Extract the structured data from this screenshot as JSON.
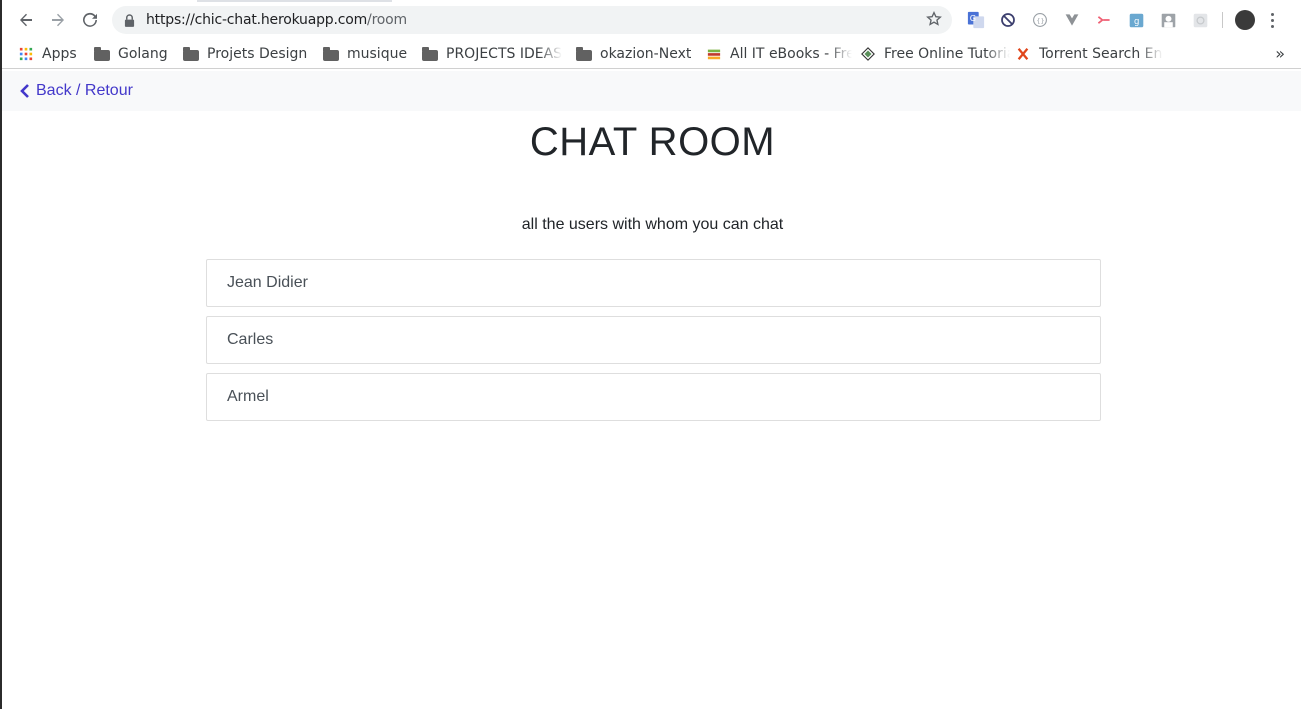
{
  "browser": {
    "url_host": "https://chic-chat.herokuapp.com",
    "url_path": "/room",
    "bookmarks": [
      {
        "label": "Apps",
        "icon": "apps-grid-icon"
      },
      {
        "label": "Golang",
        "icon": "folder-icon"
      },
      {
        "label": "Projets Design",
        "icon": "folder-icon"
      },
      {
        "label": "musique",
        "icon": "folder-icon"
      },
      {
        "label": "PROJECTS IDEAS",
        "icon": "folder-icon"
      },
      {
        "label": "okazion-Next",
        "icon": "folder-icon"
      },
      {
        "label": "All IT eBooks - Free",
        "icon": "books-icon"
      },
      {
        "label": "Free Online Tutorials",
        "icon": "diamond-icon"
      },
      {
        "label": "Torrent Search Engine",
        "icon": "x-icon"
      }
    ],
    "more_bookmarks": "»"
  },
  "page": {
    "back_label": "Back / Retour",
    "title": "CHAT ROOM",
    "subtitle": "all the users with whom you can chat",
    "users": [
      "Jean Didier",
      "Carles",
      "Armel"
    ]
  },
  "colors": {
    "link": "#4338ca",
    "nav_bg": "#f8f9fa",
    "text": "#212529"
  }
}
